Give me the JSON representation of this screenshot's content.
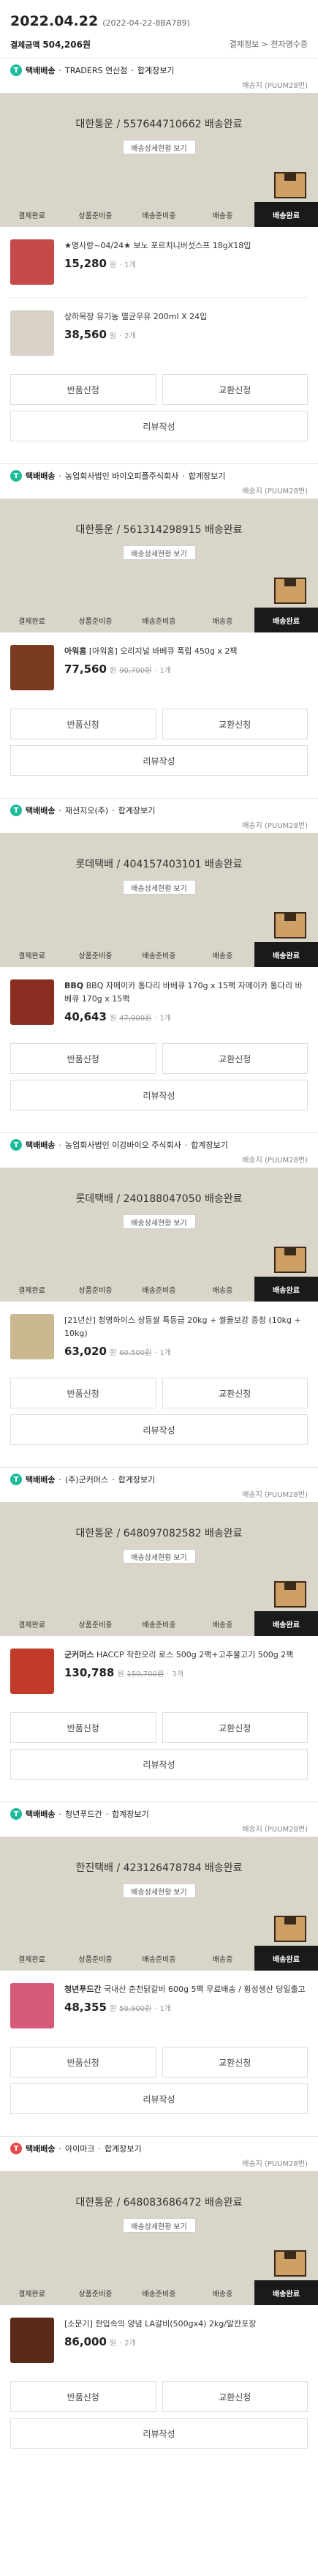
{
  "header": {
    "date": "2022.04.22",
    "order_no": "(2022-04-22-8BA789)",
    "payment_label": "결제금액",
    "payment_value": "504,206원",
    "links": "결제정보 > 전자영수증"
  },
  "steps": [
    "결제완료",
    "상품준비중",
    "배송준비중",
    "배송중",
    "배송완료"
  ],
  "buttons": {
    "return": "반품신청",
    "exchange": "교환신청",
    "review": "리뷰작성"
  },
  "groups": [
    {
      "badge_color": "#1fbc9c",
      "kind": "택배배송",
      "seller": "TRADERS 연산점",
      "bundle": "합계장보기",
      "pickup": "배송지 (PUUM28번)",
      "tracking": "대한통운 / 557644710662 배송완료",
      "track_button": "배송상세현황 보기",
      "items": [
        {
          "brand": "",
          "name": "★명사랑~04/24★ 보노 포르치니버섯스프 18gX18입",
          "price": "15,280",
          "was": "",
          "qty": "1개",
          "thumb": "#c64a4a"
        },
        {
          "brand": "",
          "name": "상하목장 유기농 멸균우유 200ml X 24입",
          "price": "38,560",
          "was": "",
          "qty": "2개",
          "thumb": "#d8d2c6"
        }
      ]
    },
    {
      "badge_color": "#1fbc9c",
      "kind": "택배배송",
      "seller": "농업회사법인 바이오피플주식회사",
      "bundle": "합계장보기",
      "pickup": "배송지 (PUUM28번)",
      "tracking": "대한통운 / 561314298915 배송완료",
      "track_button": "배송상세현황 보기",
      "items": [
        {
          "brand": "아워홈",
          "name": "[아워홈] 오리지널 바베큐 폭립 450g x 2팩",
          "price": "77,560",
          "was": "90,700원",
          "qty": "1개",
          "thumb": "#7a3b20"
        }
      ]
    },
    {
      "badge_color": "#1fbc9c",
      "kind": "택배배송",
      "seller": "재션지오(주)",
      "bundle": "합계장보기",
      "pickup": "배송지 (PUUM28번)",
      "tracking": "롯데택배 / 404157403101 배송완료",
      "track_button": "배송상세현황 보기",
      "items": [
        {
          "brand": "BBQ",
          "name": "BBQ 자메이카 통다리 바베큐 170g x 15팩 자메이카 통다리 바베큐 170g x 15팩",
          "price": "40,643",
          "was": "47,900원",
          "qty": "1개",
          "thumb": "#8a2e22"
        }
      ]
    },
    {
      "badge_color": "#1fbc9c",
      "kind": "택배배송",
      "seller": "농업회사법인 이강바이오 주식회사",
      "bundle": "합계장보기",
      "pickup": "배송지 (PUUM28번)",
      "tracking": "롯데택배 / 240188047050 배송완료",
      "track_button": "배송상세현황 보기",
      "items": [
        {
          "brand": "",
          "name": "[21년산] 청명하이스 상등쌀 특등급 20kg + 쌀을보강 증정 (10kg + 10kg)",
          "price": "63,020",
          "was": "60,500원",
          "qty": "1개",
          "thumb": "#c9b890"
        }
      ]
    },
    {
      "badge_color": "#1fbc9c",
      "kind": "택배배송",
      "seller": "(주)군커머스",
      "bundle": "합계장보기",
      "pickup": "배송지 (PUUM28번)",
      "tracking": "대한통운 / 648097082582 배송완료",
      "track_button": "배송상세현황 보기",
      "items": [
        {
          "brand": "군커머스",
          "name": "HACCP 착한오리 로스 500g 2팩+고추불고기 500g 2팩",
          "price": "130,788",
          "was": "150,700원",
          "qty": "3개",
          "thumb": "#c23a2a"
        }
      ]
    },
    {
      "badge_color": "#1fbc9c",
      "kind": "택배배송",
      "seller": "청년푸드간",
      "bundle": "합계장보기",
      "pickup": "배송지 (PUUM28번)",
      "tracking": "한진택배 / 423126478784 배송완료",
      "track_button": "배송상세현황 보기",
      "items": [
        {
          "brand": "청년푸드간",
          "name": "국내산 춘천닭갈비 600g 5팩 무료배송 / 횡성생산 당일출고",
          "price": "48,355",
          "was": "50,900원",
          "qty": "1개",
          "thumb": "#d65a7a"
        }
      ]
    },
    {
      "badge_color": "#e54b4b",
      "kind": "택배배송",
      "seller": "아이마크",
      "bundle": "합계장보기",
      "pickup": "배송지 (PUUM28번)",
      "tracking": "대한통운 / 648083686472 배송완료",
      "track_button": "배송상세현황 보기",
      "items": [
        {
          "brand": "",
          "name": "[소문기] 한입속의 양념 LA갈비(500gx4) 2kg/알칸포장",
          "price": "86,000",
          "was": "",
          "qty": "2개",
          "thumb": "#5a2a1a"
        }
      ]
    }
  ]
}
